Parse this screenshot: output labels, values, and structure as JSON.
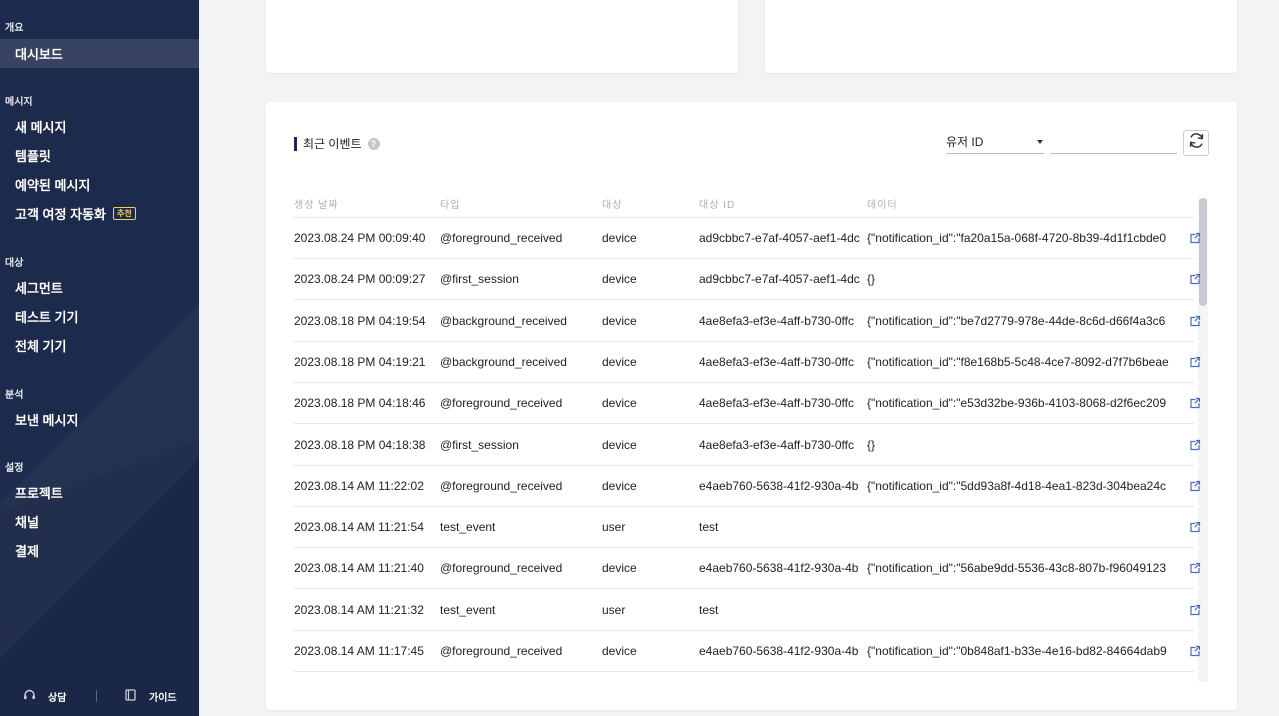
{
  "sidebar": {
    "sections": [
      {
        "heading": "개요",
        "items": [
          {
            "label": "대시보드",
            "active": true
          }
        ]
      },
      {
        "heading": "메시지",
        "items": [
          {
            "label": "새 메시지"
          },
          {
            "label": "템플릿"
          },
          {
            "label": "예약된 메시지"
          },
          {
            "label": "고객 여정 자동화",
            "badge": "추천"
          }
        ]
      },
      {
        "heading": "대상",
        "items": [
          {
            "label": "세그먼트"
          },
          {
            "label": "테스트 기기"
          },
          {
            "label": "전체 기기"
          }
        ]
      },
      {
        "heading": "분석",
        "items": [
          {
            "label": "보낸 메시지"
          }
        ]
      },
      {
        "heading": "설정",
        "items": [
          {
            "label": "프로젝트"
          },
          {
            "label": "채널"
          },
          {
            "label": "결제"
          }
        ]
      }
    ],
    "footer": {
      "consult_label": "상담",
      "guide_label": "가이드"
    }
  },
  "events": {
    "title": "최근 이벤트",
    "filter": {
      "selected": "유저 ID",
      "search_value": ""
    },
    "columns": [
      "생성 날짜",
      "타입",
      "대상",
      "대상 ID",
      "데이터"
    ],
    "rows": [
      {
        "date": "2023.08.24 PM 00:09:40",
        "type": "@foreground_received",
        "target": "device",
        "target_id": "ad9cbbc7-e7af-4057-aef1-4dc",
        "data": "{\"notification_id\":\"fa20a15a-068f-4720-8b39-4d1f1cbde0"
      },
      {
        "date": "2023.08.24 PM 00:09:27",
        "type": "@first_session",
        "target": "device",
        "target_id": "ad9cbbc7-e7af-4057-aef1-4dc",
        "data": "{}"
      },
      {
        "date": "2023.08.18 PM 04:19:54",
        "type": "@background_received",
        "target": "device",
        "target_id": "4ae8efa3-ef3e-4aff-b730-0ffc",
        "data": "{\"notification_id\":\"be7d2779-978e-44de-8c6d-d66f4a3c6"
      },
      {
        "date": "2023.08.18 PM 04:19:21",
        "type": "@background_received",
        "target": "device",
        "target_id": "4ae8efa3-ef3e-4aff-b730-0ffc",
        "data": "{\"notification_id\":\"f8e168b5-5c48-4ce7-8092-d7f7b6beae"
      },
      {
        "date": "2023.08.18 PM 04:18:46",
        "type": "@foreground_received",
        "target": "device",
        "target_id": "4ae8efa3-ef3e-4aff-b730-0ffc",
        "data": "{\"notification_id\":\"e53d32be-936b-4103-8068-d2f6ec209"
      },
      {
        "date": "2023.08.18 PM 04:18:38",
        "type": "@first_session",
        "target": "device",
        "target_id": "4ae8efa3-ef3e-4aff-b730-0ffc",
        "data": "{}"
      },
      {
        "date": "2023.08.14 AM 11:22:02",
        "type": "@foreground_received",
        "target": "device",
        "target_id": "e4aeb760-5638-41f2-930a-4b",
        "data": "{\"notification_id\":\"5dd93a8f-4d18-4ea1-823d-304bea24c"
      },
      {
        "date": "2023.08.14 AM 11:21:54",
        "type": "test_event",
        "target": "user",
        "target_id": "test",
        "data": ""
      },
      {
        "date": "2023.08.14 AM 11:21:40",
        "type": "@foreground_received",
        "target": "device",
        "target_id": "e4aeb760-5638-41f2-930a-4b",
        "data": "{\"notification_id\":\"56abe9dd-5536-43c8-807b-f96049123"
      },
      {
        "date": "2023.08.14 AM 11:21:32",
        "type": "test_event",
        "target": "user",
        "target_id": "test",
        "data": ""
      },
      {
        "date": "2023.08.14 AM 11:17:45",
        "type": "@foreground_received",
        "target": "device",
        "target_id": "e4aeb760-5638-41f2-930a-4b",
        "data": "{\"notification_id\":\"0b848af1-b33e-4e16-bd82-84664dab9"
      }
    ]
  }
}
